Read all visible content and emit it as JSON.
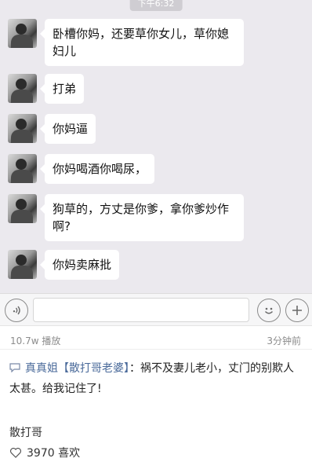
{
  "status_time": "下午6:32",
  "messages": [
    {
      "text": "卧槽你妈，还要草你女儿，草你媳妇儿"
    },
    {
      "text": "打弟"
    },
    {
      "text": "你妈逼"
    },
    {
      "text": "你妈喝酒你喝尿，"
    },
    {
      "text": "狗草的，方丈是你爹，拿你爹炒作啊?"
    },
    {
      "text": "你妈卖麻批"
    }
  ],
  "input_bar": {
    "voice_icon": "voice-icon",
    "emoji_icon": "emoji-icon",
    "plus_icon": "plus-icon"
  },
  "meta": {
    "plays": "10.7w 播放",
    "ago": "3分钟前"
  },
  "comment": {
    "author": "真真姐【散打哥老婆】",
    "separator": "：",
    "text": "祸不及妻儿老小，丈门的别欺人太甚。给我记住了!"
  },
  "poster": "散打哥",
  "likes": "3970 喜欢",
  "colors": {
    "chat_bg": "#ebe9ee",
    "bubble_bg": "#ffffff",
    "author_link": "#4a6a9a"
  }
}
